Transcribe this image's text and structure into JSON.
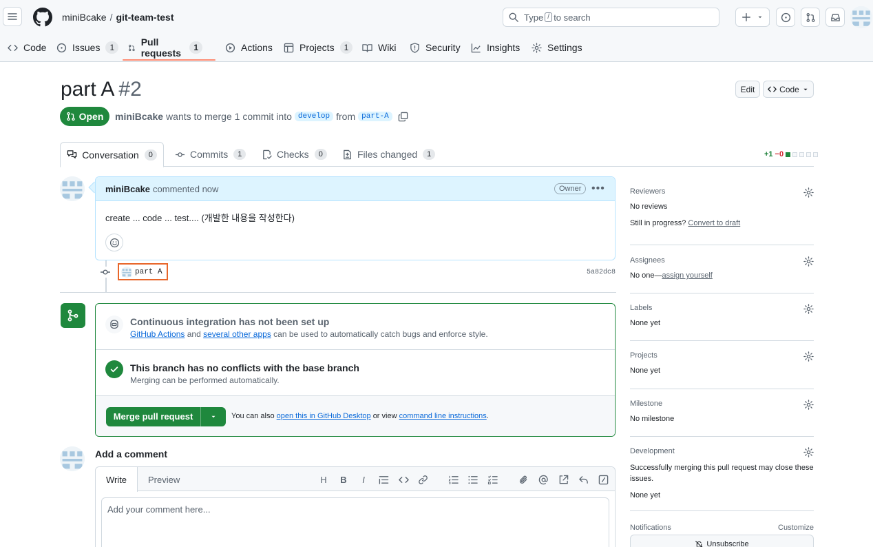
{
  "header": {
    "owner": "miniBcake",
    "separator": "/",
    "repo": "git-team-test",
    "search_prefix": "Type",
    "search_key": "/",
    "search_suffix": "to search"
  },
  "repo_tabs": [
    {
      "label": "Code",
      "count": null
    },
    {
      "label": "Issues",
      "count": "1"
    },
    {
      "label": "Pull requests",
      "count": "1"
    },
    {
      "label": "Actions",
      "count": null
    },
    {
      "label": "Projects",
      "count": "1"
    },
    {
      "label": "Wiki",
      "count": null
    },
    {
      "label": "Security",
      "count": null
    },
    {
      "label": "Insights",
      "count": null
    },
    {
      "label": "Settings",
      "count": null
    }
  ],
  "pr": {
    "title": "part A",
    "number": "#2",
    "edit_label": "Edit",
    "code_label": "Code",
    "state": "Open",
    "author": "miniBcake",
    "merge_text": "wants to merge 1 commit into",
    "base_branch": "develop",
    "from_text": "from",
    "head_branch": "part-A"
  },
  "pr_tabs": [
    {
      "label": "Conversation",
      "count": "0"
    },
    {
      "label": "Commits",
      "count": "1"
    },
    {
      "label": "Checks",
      "count": "0"
    },
    {
      "label": "Files changed",
      "count": "1"
    }
  ],
  "diffstat": {
    "additions": "+1",
    "deletions": "−0"
  },
  "comment": {
    "author": "miniBcake",
    "action": "commented now",
    "badge": "Owner",
    "body": "create ... code ... test.... (개발한 내용을 작성한다)"
  },
  "commit": {
    "message": "part A",
    "sha": "5a82dc8"
  },
  "merge": {
    "ci_title": "Continuous integration has not been set up",
    "ci_link1": "GitHub Actions",
    "ci_and": "and",
    "ci_link2": "several other apps",
    "ci_rest": "can be used to automatically catch bugs and enforce style.",
    "conflict_title": "This branch has no conflicts with the base branch",
    "conflict_sub": "Merging can be performed automatically.",
    "merge_button": "Merge pull request",
    "also_prefix": "You can also",
    "also_link1": "open this in GitHub Desktop",
    "also_mid": "or view",
    "also_link2": "command line instructions",
    "also_end": "."
  },
  "add_comment": {
    "title": "Add a comment",
    "write_tab": "Write",
    "preview_tab": "Preview",
    "placeholder": "Add your comment here..."
  },
  "sidebar": {
    "reviewers": {
      "title": "Reviewers",
      "value": "No reviews",
      "progress_text": "Still in progress?",
      "draft_link": "Convert to draft"
    },
    "assignees": {
      "title": "Assignees",
      "value": "No one—",
      "assign_link": "assign yourself"
    },
    "labels": {
      "title": "Labels",
      "value": "None yet"
    },
    "projects": {
      "title": "Projects",
      "value": "None yet"
    },
    "milestone": {
      "title": "Milestone",
      "value": "No milestone"
    },
    "development": {
      "title": "Development",
      "desc": "Successfully merging this pull request may close these issues.",
      "value": "None yet"
    },
    "notifications": {
      "title": "Notifications",
      "customize": "Customize",
      "unsubscribe": "Unsubscribe"
    }
  }
}
